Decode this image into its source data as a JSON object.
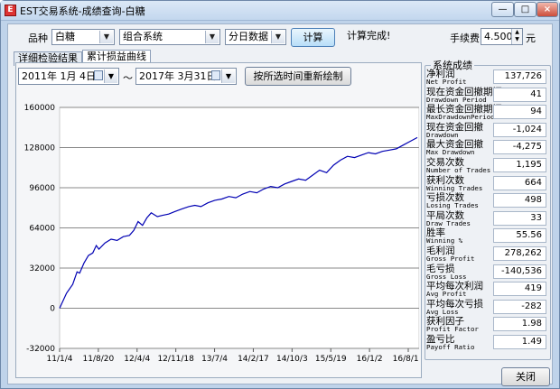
{
  "window": {
    "title": "EST交易系统-成绩查询-白糖"
  },
  "toolbar": {
    "variety_label": "品种",
    "variety_value": "白糖",
    "system_value": "组合系统",
    "data_value": "分日数据",
    "calc_button": "计算",
    "status": "计算完成!",
    "fee_label": "手续费",
    "fee_value": "4.500",
    "fee_unit": "元"
  },
  "tabs": [
    "详细检验结果",
    "累计损益曲线"
  ],
  "date_range": {
    "start": "2011年 1月 4日",
    "separator": "～",
    "end": "2017年 3月31日",
    "redraw_button": "按所选时间重新绘制"
  },
  "chart_data": {
    "type": "line",
    "title": "",
    "xlabel": "",
    "ylabel": "",
    "ylim": [
      -32000,
      160000
    ],
    "yticks": [
      -32000,
      0,
      32000,
      64000,
      96000,
      128000,
      160000
    ],
    "ytick_labels": [
      "-32000",
      "0",
      "32000",
      "64000",
      "96000",
      "128000",
      "160000"
    ],
    "xtick_labels": [
      "11/1/4",
      "11/8/20",
      "12/4/4",
      "12/11/18",
      "13/7/4",
      "14/2/17",
      "14/10/3",
      "15/5/19",
      "16/1/2",
      "16/8/17"
    ],
    "grid": "horizontal",
    "series": [
      {
        "color": "#0000b3",
        "x": [
          0,
          8,
          15,
          20,
          23,
          28,
          33,
          38,
          42,
          45,
          52,
          59,
          66,
          73,
          80,
          85,
          90,
          95,
          100,
          105,
          112,
          118,
          125,
          132,
          140,
          148,
          155,
          162,
          170,
          178,
          186,
          194,
          202,
          210,
          218,
          226,
          234,
          242,
          250,
          258,
          266,
          274,
          282,
          290,
          298,
          306,
          314,
          322,
          330,
          338,
          346,
          354,
          362,
          370,
          378,
          386,
          394,
          402,
          410
        ],
        "y": [
          0,
          12000,
          19000,
          29000,
          28000,
          36000,
          42000,
          44000,
          50000,
          47000,
          52000,
          55000,
          54000,
          57000,
          58000,
          62000,
          69000,
          66000,
          72000,
          76000,
          73000,
          74000,
          75000,
          77000,
          79000,
          81000,
          82000,
          81000,
          84000,
          86000,
          87000,
          89000,
          88000,
          91000,
          93000,
          92000,
          95000,
          97000,
          96000,
          99000,
          101000,
          103000,
          102000,
          106000,
          110000,
          108000,
          114000,
          118000,
          121000,
          120000,
          122000,
          124000,
          123000,
          125000,
          126000,
          127000,
          130000,
          133000,
          136000
        ]
      }
    ]
  },
  "stats": {
    "group_title": "系统成绩",
    "rows": [
      {
        "cn": "净利润",
        "en": "Net Profit",
        "value": "137,726"
      },
      {
        "cn": "现在资金回撤期间",
        "en": "Drawdown Period",
        "value": "41"
      },
      {
        "cn": "最长资金回撤期间",
        "en": "MaxDrawdownPeriod",
        "value": "94"
      },
      {
        "cn": "现在资金回撤",
        "en": "Drawdown",
        "value": "-1,024"
      },
      {
        "cn": "最大资金回撤",
        "en": "Max Drawdown",
        "value": "-4,275"
      },
      {
        "cn": "交易次数",
        "en": "Number of Trades",
        "value": "1,195"
      },
      {
        "cn": "获利次数",
        "en": "Winning Trades",
        "value": "664"
      },
      {
        "cn": "亏损次数",
        "en": "Losing Trades",
        "value": "498"
      },
      {
        "cn": "平局次数",
        "en": "Draw Trades",
        "value": "33"
      },
      {
        "cn": "胜率",
        "en": "Winning %",
        "value": "55.56"
      },
      {
        "cn": "毛利润",
        "en": "Gross Profit",
        "value": "278,262"
      },
      {
        "cn": "毛亏损",
        "en": "Gross Loss",
        "value": "-140,536"
      },
      {
        "cn": "平均每次利润",
        "en": "Avg Profit",
        "value": "419"
      },
      {
        "cn": "平均每次亏损",
        "en": "Avg Loss",
        "value": "-282"
      },
      {
        "cn": "获利因子",
        "en": "Profit Factor",
        "value": "1.98"
      },
      {
        "cn": "盈亏比",
        "en": "Payoff Ratio",
        "value": "1.49"
      }
    ],
    "close_button": "关闭"
  },
  "colors": {
    "line": "#0000b3",
    "window_frame": "#bfd3ea",
    "client_bg": "#eef1f5"
  }
}
